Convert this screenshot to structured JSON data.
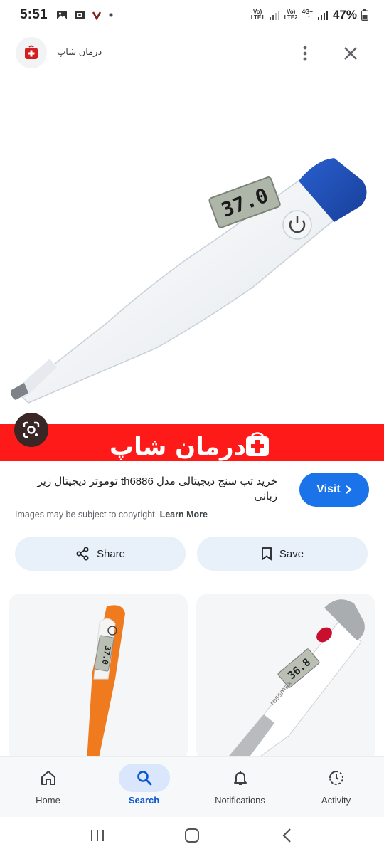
{
  "status_bar": {
    "time": "5:51",
    "sim1_label": "Vo) LTE1",
    "sim2_label": "Vo) LTE2",
    "network": "4G+",
    "battery": "47%"
  },
  "header": {
    "site_name": "درمان شاپ",
    "more_icon": "more-vert-icon",
    "close_icon": "close-icon"
  },
  "image_banner": {
    "brand_text": "درمان شاپ",
    "lcd_reading": "37.0",
    "banner_color": "#ff1a1a"
  },
  "result": {
    "title": "خرید تب سنج دیجیتالی مدل th6886 توموتر دیجیتال زیر زبانی",
    "visit_label": "Visit",
    "copyright_text": "Images may be subject to copyright.",
    "learn_more": "Learn More"
  },
  "actions": {
    "share_label": "Share",
    "save_label": "Save"
  },
  "related": {
    "card1_reading": "37.0",
    "card2_reading": "36.8",
    "card2_brand": "rossmax"
  },
  "bottom_nav": {
    "items": [
      {
        "label": "Home",
        "icon": "home-icon"
      },
      {
        "label": "Search",
        "icon": "search-icon"
      },
      {
        "label": "Notifications",
        "icon": "bell-icon"
      },
      {
        "label": "Activity",
        "icon": "activity-icon"
      }
    ],
    "active": "Search"
  },
  "colors": {
    "accent": "#1a73e8",
    "thermo_cap": "#1d4fb5",
    "orange": "#f07a1e"
  }
}
